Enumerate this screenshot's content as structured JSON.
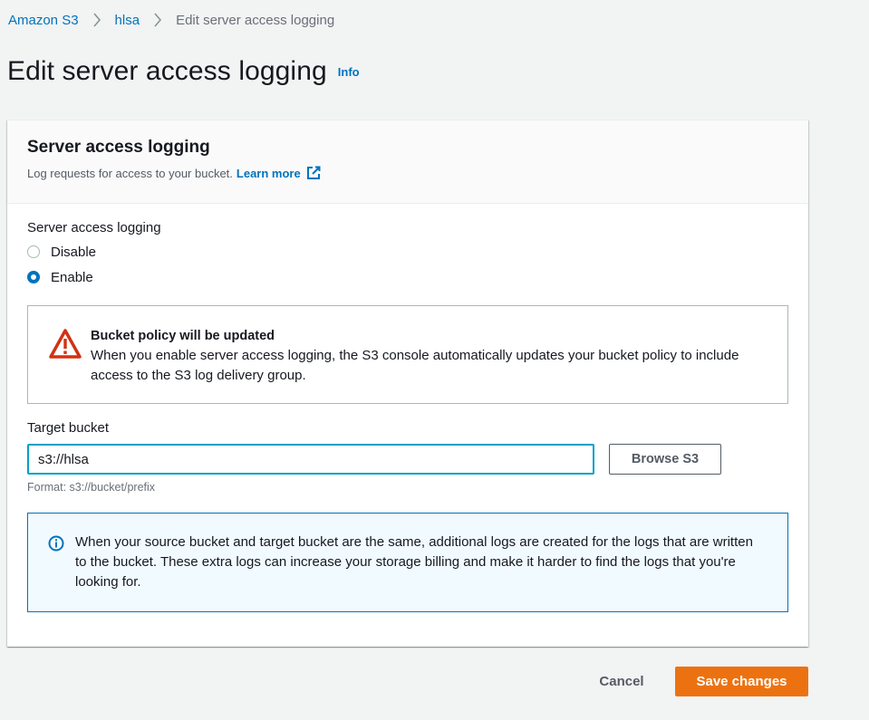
{
  "breadcrumb": {
    "items": [
      {
        "label": "Amazon S3"
      },
      {
        "label": "hlsa"
      },
      {
        "label": "Edit server access logging"
      }
    ]
  },
  "header": {
    "title": "Edit server access logging",
    "info_label": "Info"
  },
  "section": {
    "title": "Server access logging",
    "description": "Log requests for access to your bucket.",
    "learn_more": "Learn more",
    "field_label": "Server access logging",
    "options": [
      {
        "label": "Disable",
        "selected": false
      },
      {
        "label": "Enable",
        "selected": true
      }
    ]
  },
  "warning": {
    "title": "Bucket policy will be updated",
    "body": "When you enable server access logging, the S3 console automatically updates your bucket policy to include access to the S3 log delivery group.",
    "icon": "warning-triangle-icon",
    "color": "#d13212"
  },
  "target": {
    "label": "Target bucket",
    "value": "s3://hlsa",
    "browse_label": "Browse S3",
    "hint": "Format: s3://bucket/prefix"
  },
  "info_alert": {
    "body": "When your source bucket and target bucket are the same, additional logs are created for the logs that are written to the bucket. These extra logs can increase your storage billing and make it harder to find the logs that you're looking for.",
    "icon": "info-circle-icon",
    "color": "#0073bb"
  },
  "actions": {
    "cancel_label": "Cancel",
    "save_label": "Save changes",
    "save_color": "#ec7211"
  }
}
